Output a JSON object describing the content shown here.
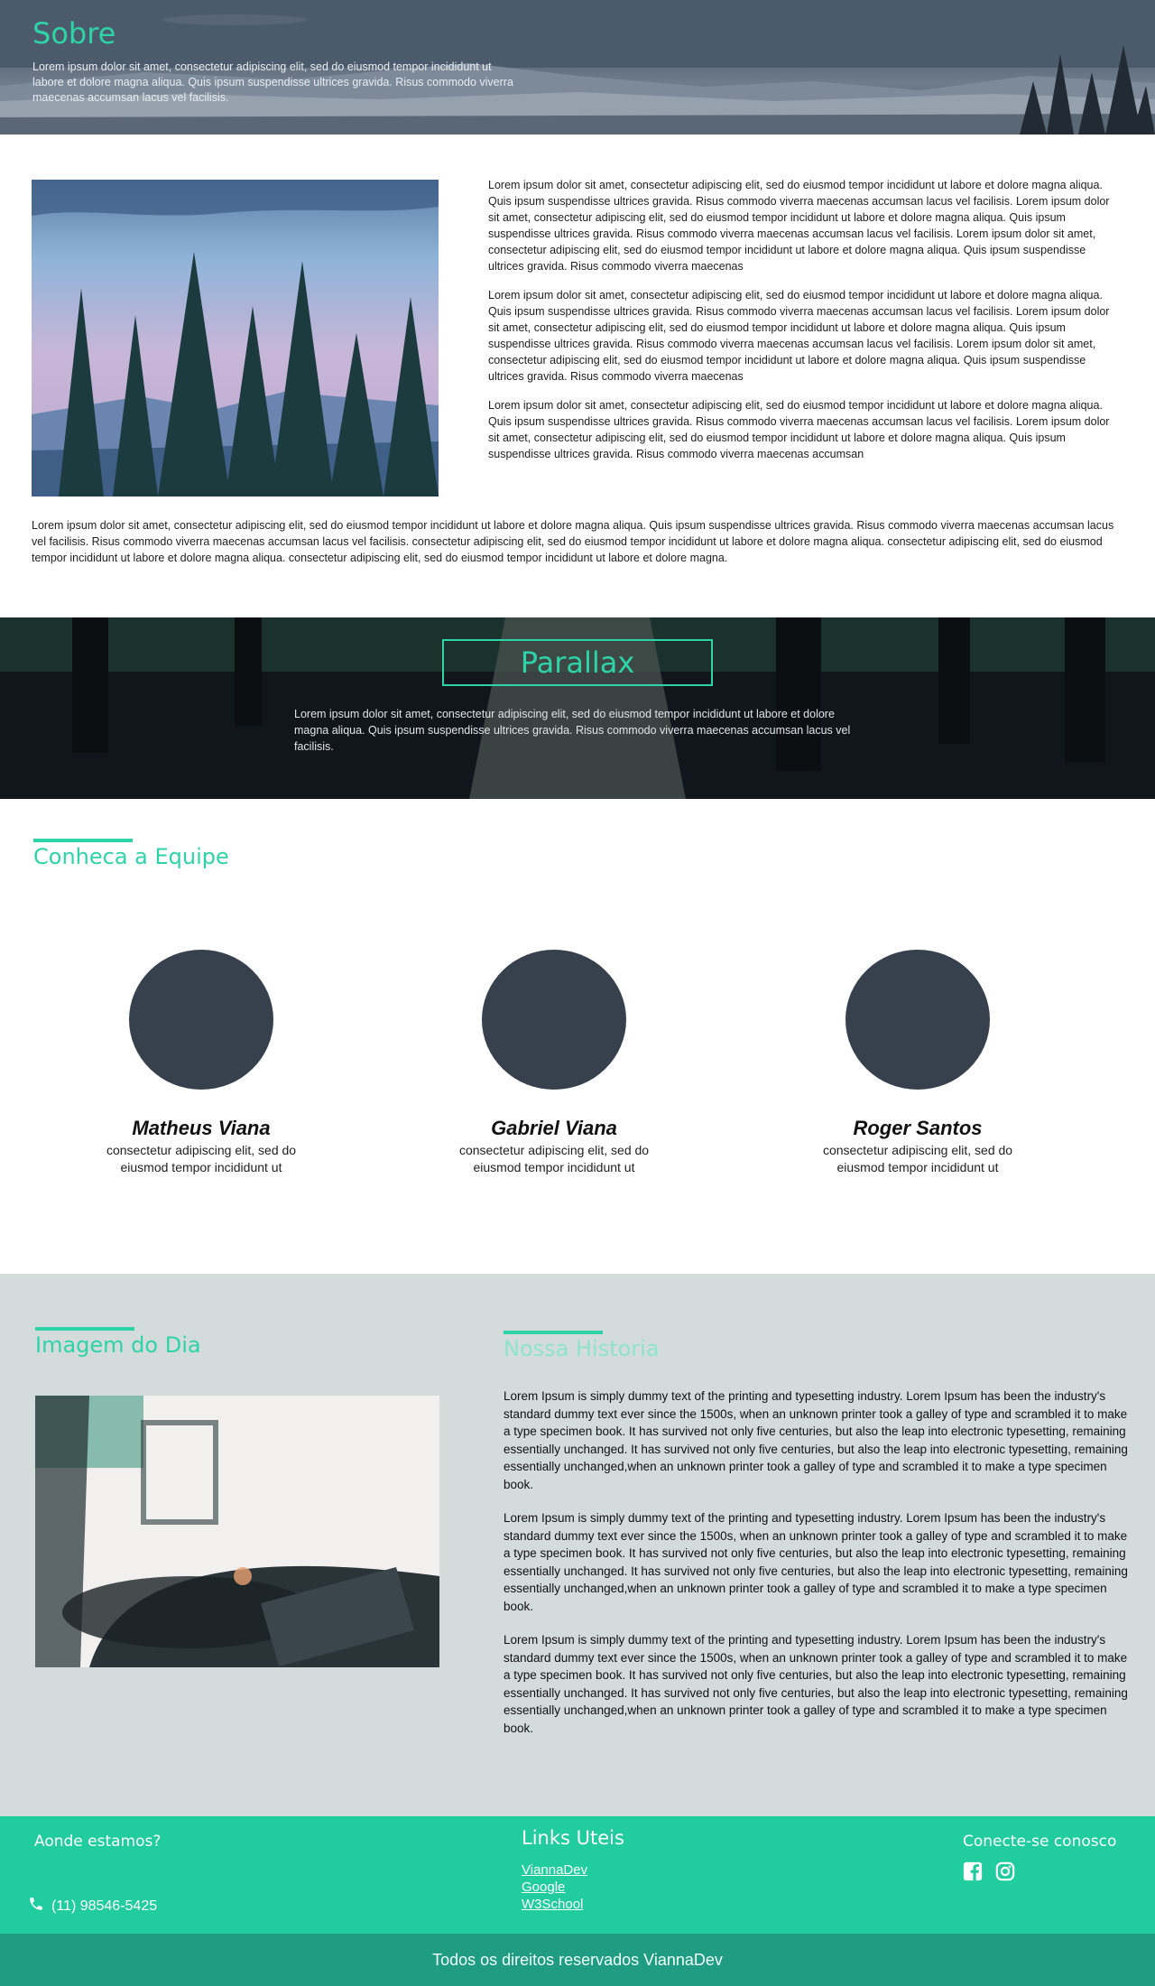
{
  "hero": {
    "title": "Sobre",
    "text": "Lorem ipsum dolor sit amet, consectetur adipiscing elit, sed do eiusmod tempor incididunt ut labore et dolore magna aliqua. Quis ipsum suspendisse ultrices gravida. Risus commodo viverra maecenas accumsan lacus vel facilisis."
  },
  "about": {
    "paragraphs": [
      "Lorem ipsum dolor sit amet, consectetur adipiscing elit, sed do eiusmod tempor incididunt ut labore et dolore magna aliqua. Quis ipsum suspendisse ultrices gravida. Risus commodo viverra maecenas accumsan lacus vel facilisis. Lorem ipsum dolor sit amet, consectetur adipiscing elit, sed do eiusmod tempor incididunt ut labore et dolore magna aliqua. Quis ipsum suspendisse ultrices gravida. Risus commodo viverra maecenas accumsan lacus vel facilisis. Lorem ipsum dolor sit amet, consectetur adipiscing elit, sed do eiusmod tempor incididunt ut labore et dolore magna aliqua. Quis ipsum suspendisse ultrices gravida. Risus commodo viverra maecenas",
      "Lorem ipsum dolor sit amet, consectetur adipiscing elit, sed do eiusmod tempor incididunt ut labore et dolore magna aliqua. Quis ipsum suspendisse ultrices gravida. Risus commodo viverra maecenas accumsan lacus vel facilisis. Lorem ipsum dolor sit amet, consectetur adipiscing elit, sed do eiusmod tempor incididunt ut labore et dolore magna aliqua. Quis ipsum suspendisse ultrices gravida. Risus commodo viverra maecenas accumsan lacus vel facilisis. Lorem ipsum dolor sit amet, consectetur adipiscing elit, sed do eiusmod tempor incididunt ut labore et dolore magna aliqua. Quis ipsum suspendisse ultrices gravida. Risus commodo viverra maecenas",
      "Lorem ipsum dolor sit amet, consectetur adipiscing elit, sed do eiusmod tempor incididunt ut labore et dolore magna aliqua. Quis ipsum suspendisse ultrices gravida. Risus commodo viverra maecenas accumsan lacus vel facilisis. Lorem ipsum dolor sit amet, consectetur adipiscing elit, sed do eiusmod tempor incididunt ut labore et dolore magna aliqua. Quis ipsum suspendisse ultrices gravida. Risus commodo viverra maecenas accumsan"
    ],
    "full": "Lorem ipsum dolor sit amet, consectetur adipiscing elit, sed do eiusmod tempor incididunt ut labore et dolore magna aliqua. Quis ipsum suspendisse ultrices gravida. Risus commodo viverra maecenas accumsan lacus vel facilisis. Risus commodo viverra maecenas accumsan lacus vel facilisis. consectetur adipiscing elit, sed do eiusmod tempor incididunt ut labore et dolore magna aliqua. consectetur adipiscing elit, sed do eiusmod tempor incididunt ut labore et dolore magna aliqua. consectetur adipiscing elit, sed do eiusmod tempor incididunt ut labore et dolore magna."
  },
  "parallax": {
    "title": "Parallax",
    "text": "Lorem ipsum dolor sit amet, consectetur adipiscing elit, sed do eiusmod tempor incididunt ut labore et dolore magna aliqua. Quis ipsum suspendisse ultrices gravida. Risus commodo viverra maecenas accumsan lacus vel facilisis."
  },
  "team": {
    "title": "Conheca a Equipe",
    "members": [
      {
        "name": "Matheus Viana",
        "desc": "consectetur adipiscing elit, sed do eiusmod tempor incididunt ut"
      },
      {
        "name": "Gabriel Viana",
        "desc": "consectetur adipiscing elit, sed do eiusmod tempor incididunt ut"
      },
      {
        "name": "Roger Santos",
        "desc": "consectetur adipiscing elit, sed do eiusmod tempor incididunt ut"
      }
    ]
  },
  "day": {
    "title": "Imagem do Dia"
  },
  "history": {
    "title": "Nossa Historia",
    "paragraphs": [
      "Lorem Ipsum is simply dummy text of the printing and typesetting industry. Lorem Ipsum has been the industry's standard dummy text ever since the 1500s, when an unknown printer took a galley of type and scrambled it to make a type specimen book. It has survived not only five centuries, but also the leap into electronic typesetting, remaining essentially unchanged. It has survived not only five centuries, but also the leap into electronic typesetting, remaining essentially unchanged,when an unknown printer took a galley of type and scrambled it to make a type specimen book.",
      "Lorem Ipsum is simply dummy text of the printing and typesetting industry. Lorem Ipsum has been the industry's standard dummy text ever since the 1500s, when an unknown printer took a galley of type and scrambled it to make a type specimen book. It has survived not only five centuries, but also the leap into electronic typesetting, remaining essentially unchanged. It has survived not only five centuries, but also the leap into electronic typesetting, remaining essentially unchanged,when an unknown printer took a galley of type and scrambled it to make a type specimen book.",
      "Lorem Ipsum is simply dummy text of the printing and typesetting industry. Lorem Ipsum has been the industry's standard dummy text ever since the 1500s, when an unknown printer took a galley of type and scrambled it to make a type specimen book. It has survived not only five centuries, but also the leap into electronic typesetting, remaining essentially unchanged. It has survived not only five centuries, but also the leap into electronic typesetting, remaining essentially unchanged,when an unknown printer took a galley of type and scrambled it to make a type specimen book."
    ]
  },
  "footer": {
    "where": "Aonde estamos?",
    "phone": "(11) 98546-5425",
    "links_title": "Links Uteis",
    "links": [
      "ViannaDev",
      "Google",
      "W3School"
    ],
    "connect": "Conecte-se conosco",
    "copyright": "Todos os direitos reservados ViannaDev"
  },
  "colors": {
    "accent": "#2ed3a8",
    "footer": "#21cc9e",
    "footer_bottom": "#1f9c82",
    "gray_section": "#d3dbdb",
    "avatar": "#37414d"
  },
  "icons": {
    "phone": "phone-icon",
    "facebook": "facebook-icon",
    "instagram": "instagram-icon"
  }
}
